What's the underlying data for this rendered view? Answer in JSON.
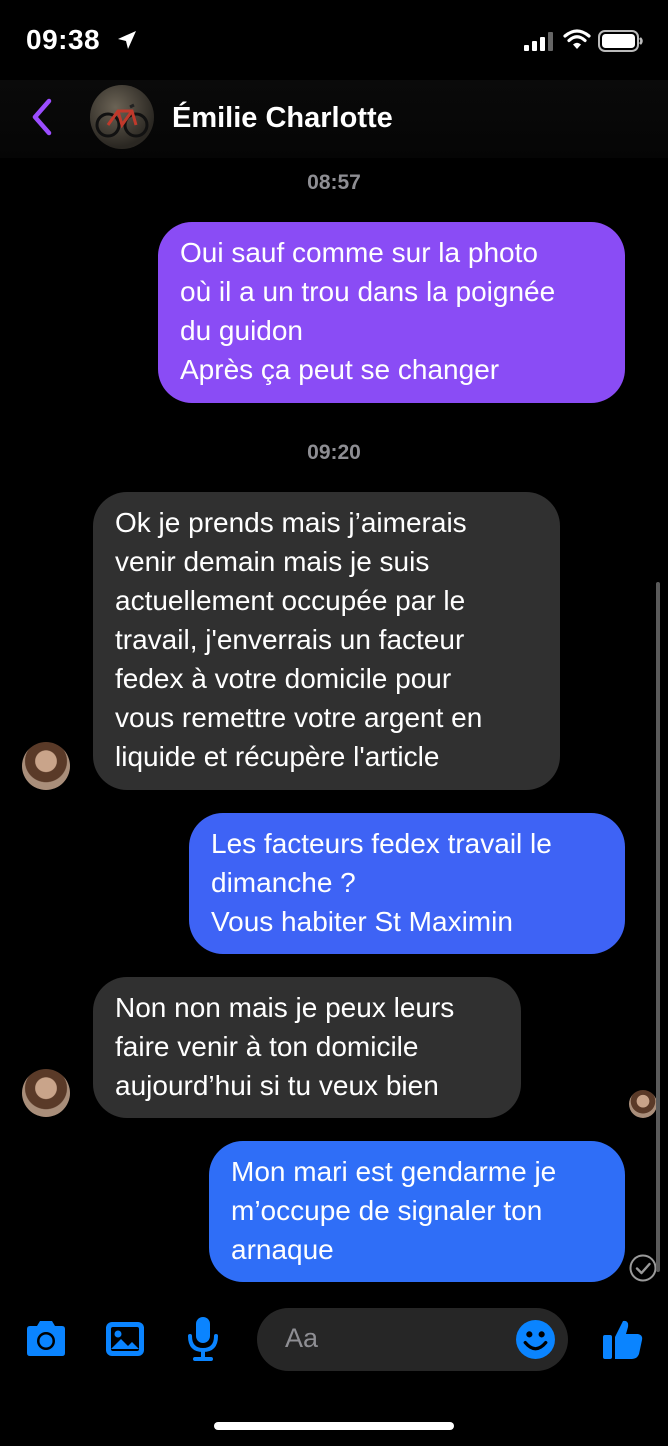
{
  "status_bar": {
    "time": "09:38"
  },
  "header": {
    "contact_name": "Émilie Charlotte"
  },
  "conversation": {
    "timestamps": [
      "08:57",
      "09:20"
    ],
    "messages": [
      {
        "direction": "outgoing",
        "color": "#8a4cf5",
        "lines": [
          "Oui sauf comme sur la photo",
          "où il a un trou dans la poignée",
          "du guidon",
          "Après ça peut se changer"
        ]
      },
      {
        "direction": "incoming",
        "color": "#303030",
        "lines": [
          "Ok je prends mais j’aimerais",
          "venir demain mais je suis",
          "actuellement occupée par le",
          "travail, j'enverrais un facteur",
          "fedex à votre domicile pour",
          "vous remettre votre argent en",
          "liquide et récupère l'article"
        ]
      },
      {
        "direction": "outgoing",
        "color": "#3e63f5",
        "lines": [
          "Les facteurs fedex travail le",
          "dimanche ?",
          "Vous habiter St Maximin"
        ]
      },
      {
        "direction": "incoming",
        "color": "#303030",
        "lines": [
          "Non non mais je peux leurs",
          "faire venir à ton domicile",
          "aujourd’hui si tu veux bien"
        ]
      },
      {
        "direction": "outgoing",
        "color": "#2f6ef7",
        "lines": [
          "Mon mari est gendarme je",
          "m’occupe de signaler ton",
          "arnaque"
        ]
      }
    ]
  },
  "composer": {
    "placeholder": "Aa"
  },
  "colors": {
    "accent": "#0a84ff",
    "back_arrow": "#9b4dff"
  },
  "icons": [
    "location-arrow-icon",
    "signal-icon",
    "wifi-icon",
    "battery-icon",
    "back-chevron-icon",
    "camera-icon",
    "image-icon",
    "microphone-icon",
    "emoji-icon",
    "thumbs-up-icon",
    "sent-check-icon"
  ]
}
